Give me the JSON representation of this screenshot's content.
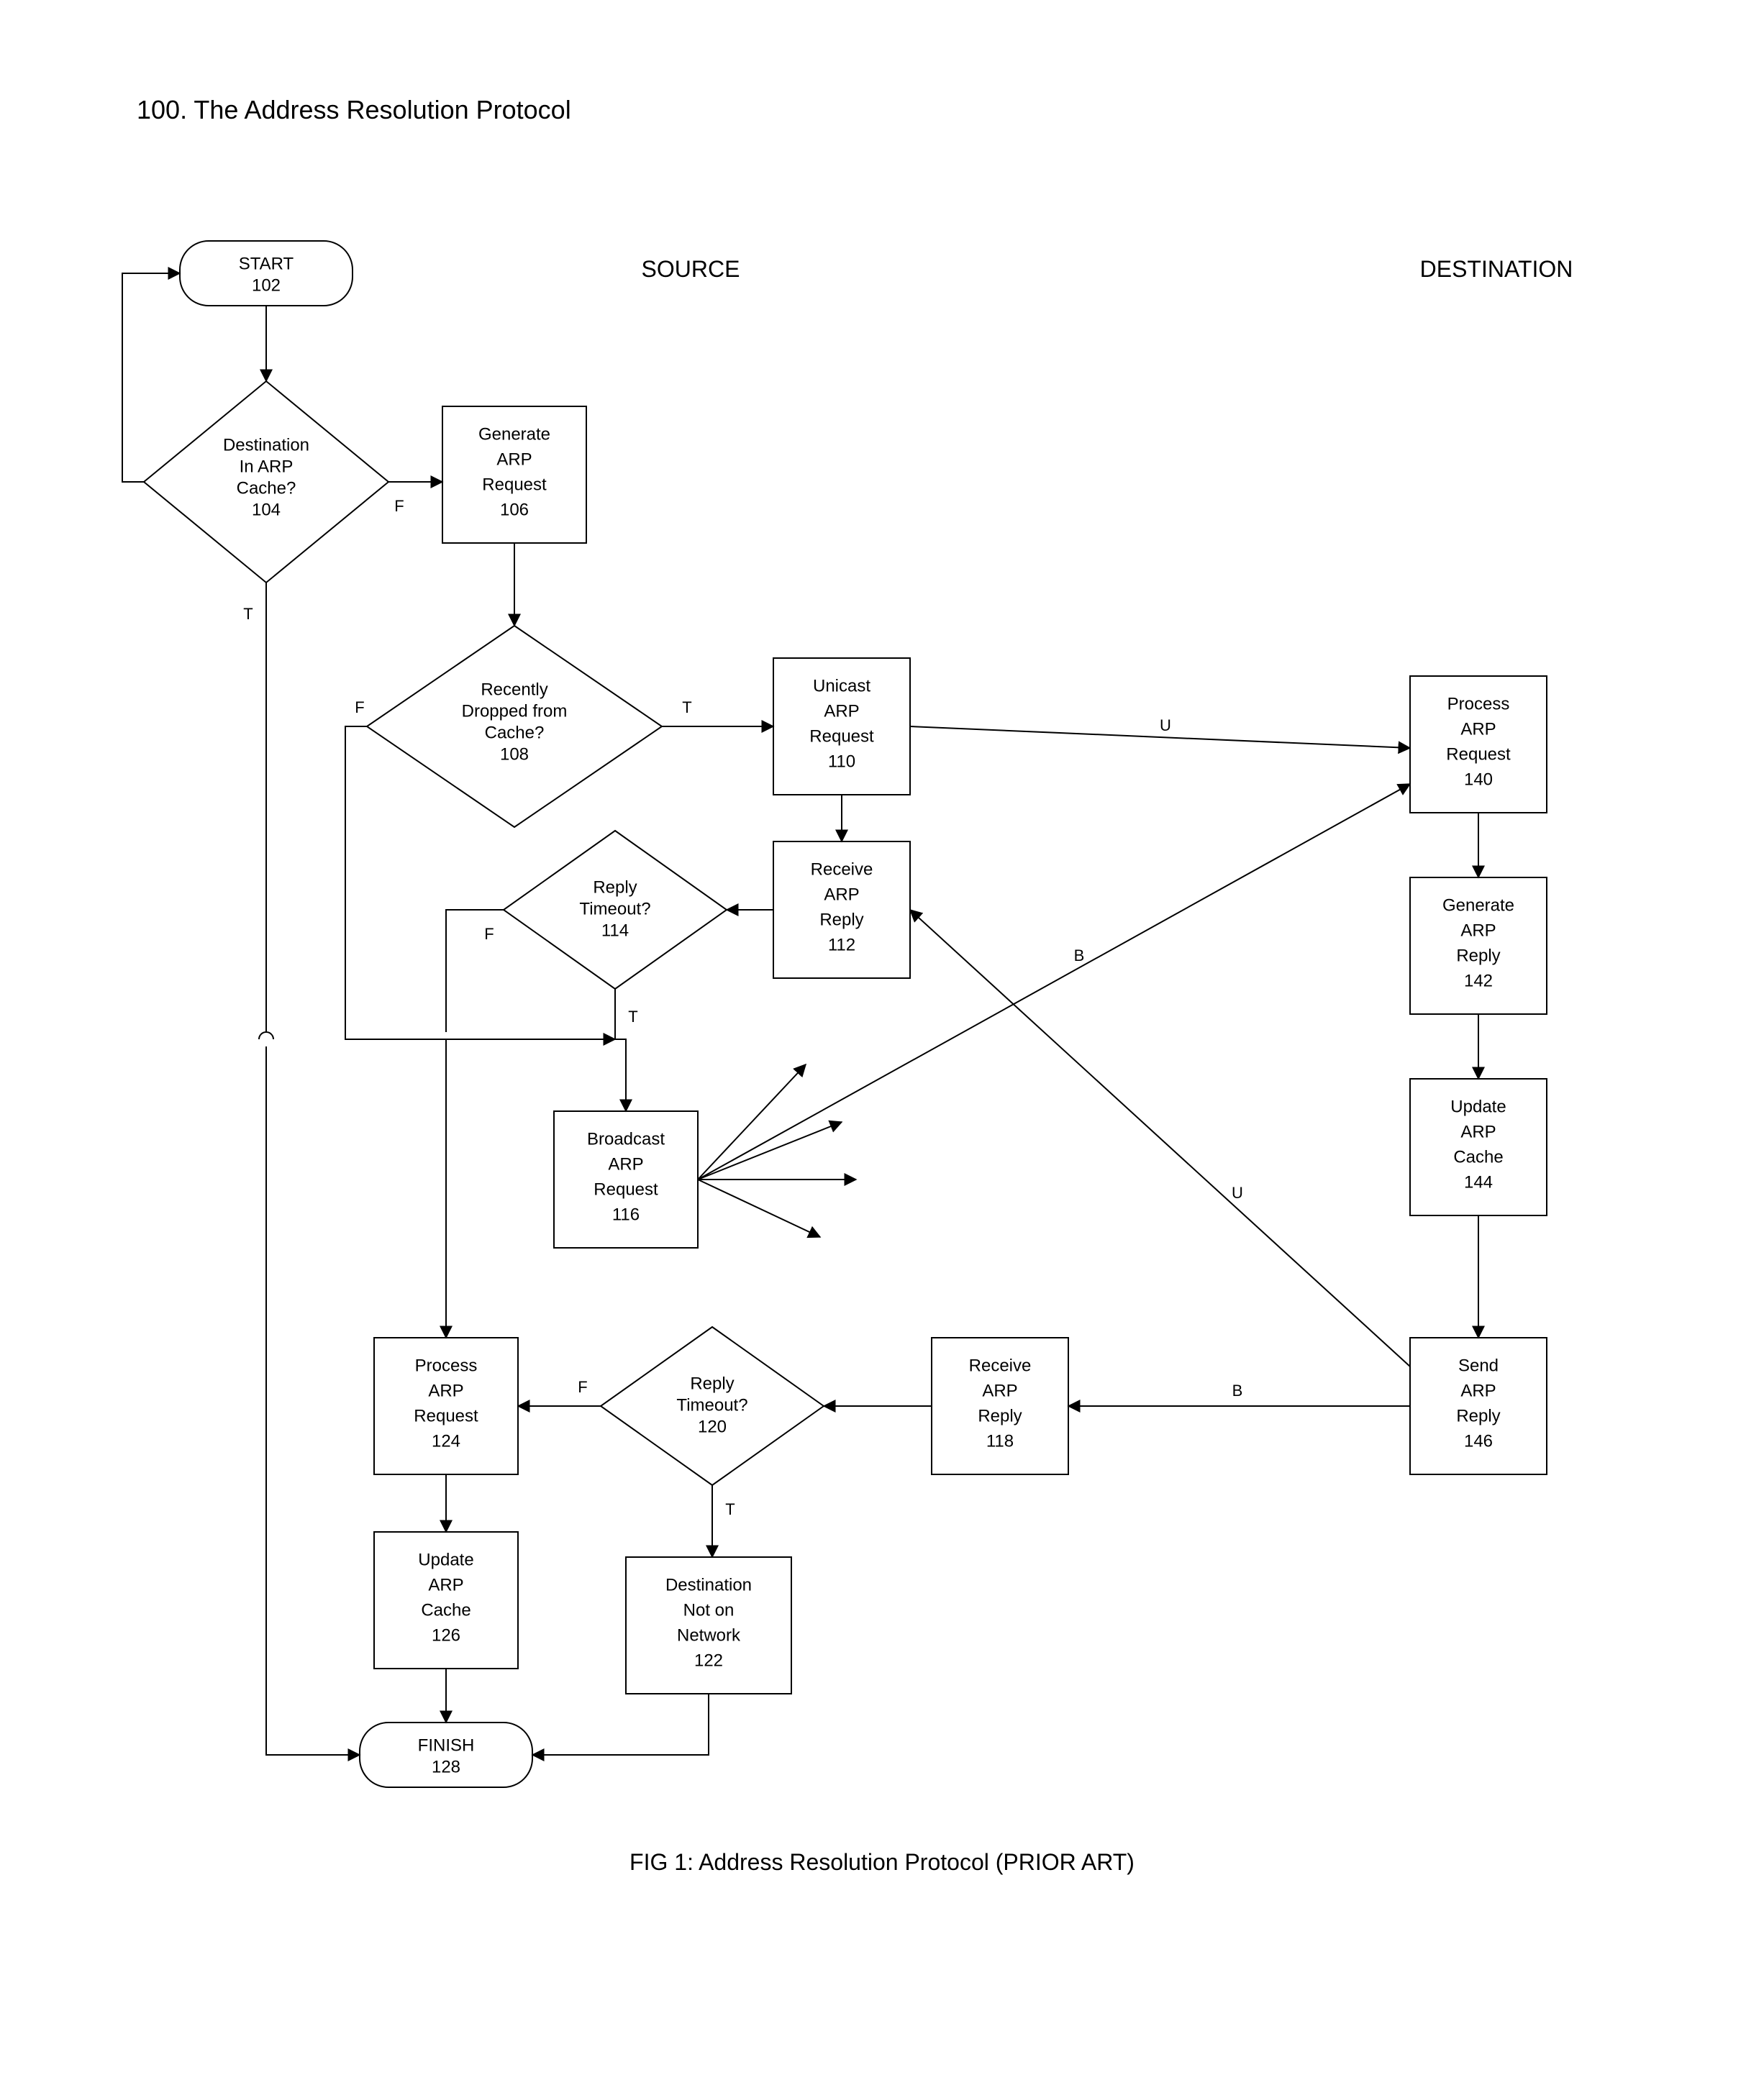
{
  "title": "100. The Address Resolution Protocol",
  "headers": {
    "source": "SOURCE",
    "destination": "DESTINATION"
  },
  "caption": "FIG 1: Address Resolution Protocol (PRIOR ART)",
  "nodes": {
    "start": {
      "lines": [
        "START",
        "102"
      ]
    },
    "in_cache": {
      "lines": [
        "Destination",
        "In ARP",
        "Cache?",
        "104"
      ]
    },
    "gen_req": {
      "lines": [
        "Generate",
        "ARP",
        "Request",
        "106"
      ]
    },
    "recently_dropped": {
      "lines": [
        "Recently",
        "Dropped from",
        "Cache?",
        "108"
      ]
    },
    "unicast_req": {
      "lines": [
        "Unicast",
        "ARP",
        "Request",
        "110"
      ]
    },
    "recv_reply_112": {
      "lines": [
        "Receive",
        "ARP",
        "Reply",
        "112"
      ]
    },
    "reply_to_114": {
      "lines": [
        "Reply",
        "Timeout?",
        "114"
      ]
    },
    "broadcast_req": {
      "lines": [
        "Broadcast",
        "ARP",
        "Request",
        "116"
      ]
    },
    "recv_reply_118": {
      "lines": [
        "Receive",
        "ARP",
        "Reply",
        "118"
      ]
    },
    "reply_to_120": {
      "lines": [
        "Reply",
        "Timeout?",
        "120"
      ]
    },
    "not_on_network": {
      "lines": [
        "Destination",
        "Not on",
        "Network",
        "122"
      ]
    },
    "process_req_124": {
      "lines": [
        "Process",
        "ARP",
        "Request",
        "124"
      ]
    },
    "update_cache_126": {
      "lines": [
        "Update",
        "ARP",
        "Cache",
        "126"
      ]
    },
    "finish": {
      "lines": [
        "FINISH",
        "128"
      ]
    },
    "process_req_140": {
      "lines": [
        "Process",
        "ARP",
        "Request",
        "140"
      ]
    },
    "gen_reply_142": {
      "lines": [
        "Generate",
        "ARP",
        "Reply",
        "142"
      ]
    },
    "update_cache_144": {
      "lines": [
        "Update",
        "ARP",
        "Cache",
        "144"
      ]
    },
    "send_reply_146": {
      "lines": [
        "Send",
        "ARP",
        "Reply",
        "146"
      ]
    }
  },
  "edge_labels": {
    "T": "T",
    "F": "F",
    "U": "U",
    "B": "B"
  }
}
